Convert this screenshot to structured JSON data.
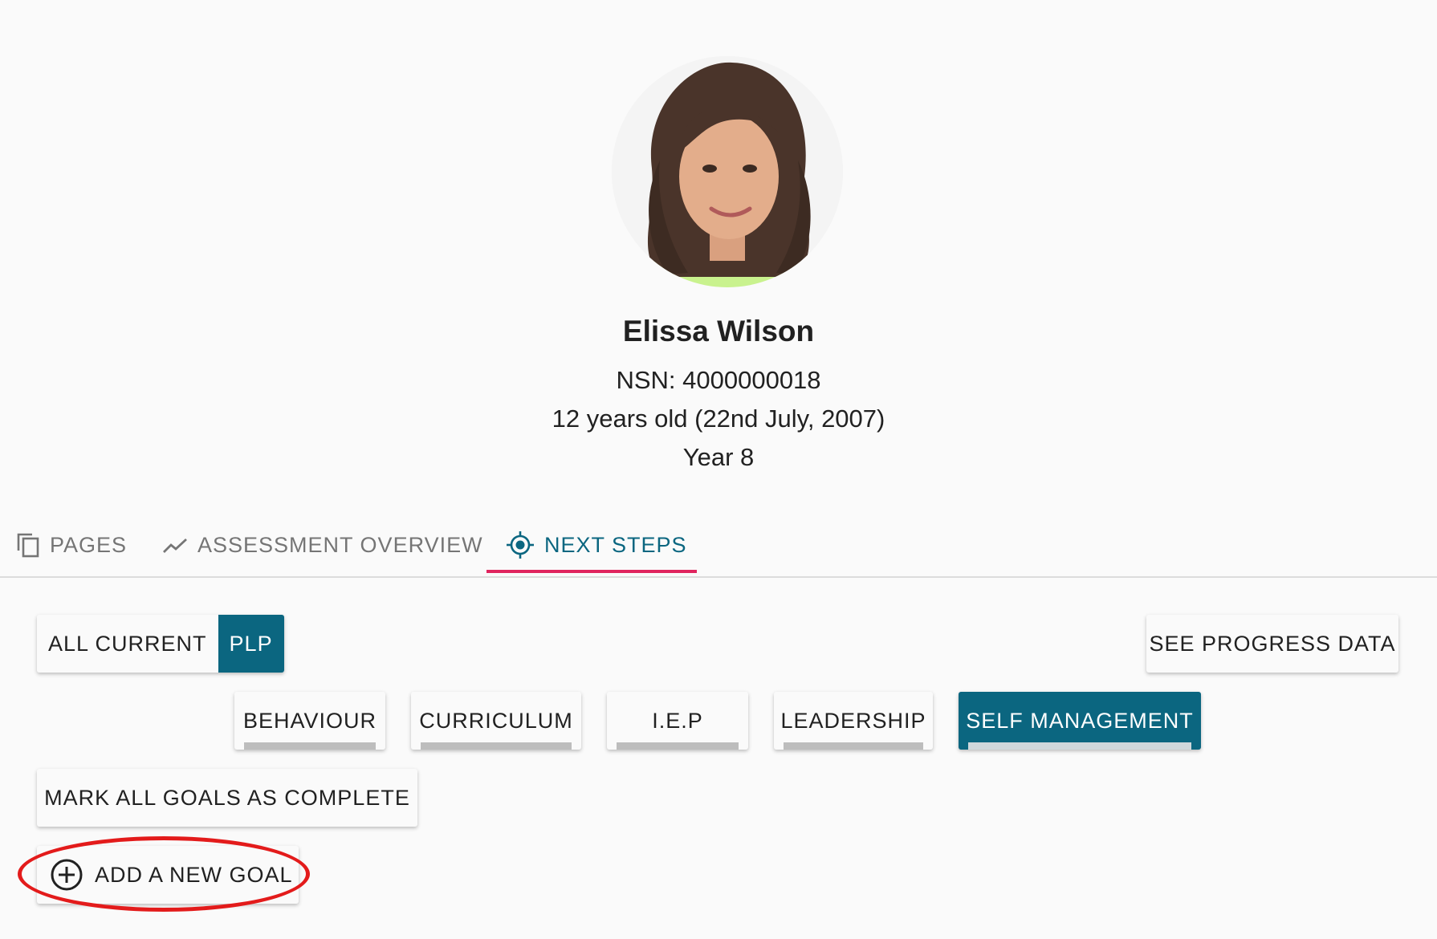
{
  "student": {
    "name": "Elissa Wilson",
    "nsn": "NSN: 4000000018",
    "age": "12 years old (22nd July, 2007)",
    "year": "Year 8"
  },
  "tabs": [
    {
      "label": "PAGES",
      "icon": "pages-icon",
      "active": false
    },
    {
      "label": "ASSESSMENT OVERVIEW",
      "icon": "trending-icon",
      "active": false
    },
    {
      "label": "NEXT STEPS",
      "icon": "target-icon",
      "active": true
    }
  ],
  "filter_toggle": {
    "off_label": "ALL CURRENT",
    "on_label": "PLP"
  },
  "progress_button": "SEE PROGRESS DATA",
  "categories": [
    {
      "label": "BEHAVIOUR",
      "active": false
    },
    {
      "label": "CURRICULUM",
      "active": false
    },
    {
      "label": "I.E.P",
      "active": false
    },
    {
      "label": "LEADERSHIP",
      "active": false
    },
    {
      "label": "SELF MANAGEMENT",
      "active": true
    }
  ],
  "mark_complete_button": "MARK ALL GOALS AS COMPLETE",
  "add_goal_button": "ADD A NEW GOAL",
  "colors": {
    "accent": "#0b6680",
    "tab_indicator": "#e0245e",
    "highlight": "#e31b1b"
  }
}
